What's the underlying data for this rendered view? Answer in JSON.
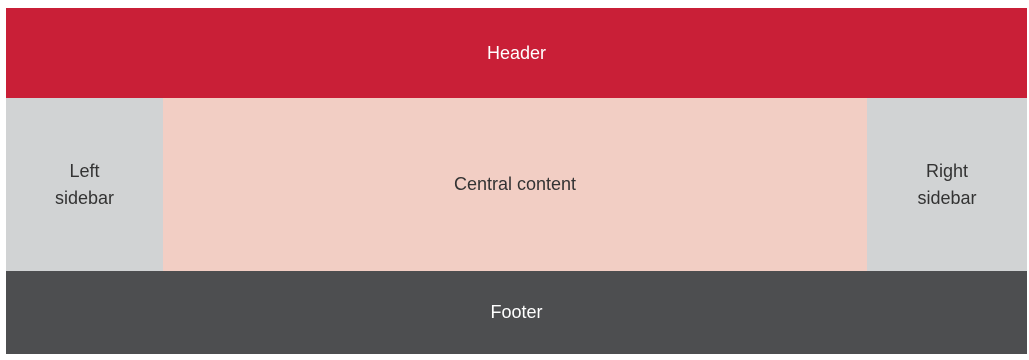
{
  "layout": {
    "header": {
      "label": "Header",
      "color": "#c91f37",
      "text_color": "#ffffff"
    },
    "left_sidebar": {
      "label": "Left sidebar",
      "color": "#d1d3d4",
      "text_color": "#333333"
    },
    "central_content": {
      "label": "Central content",
      "color": "#f2cec4",
      "text_color": "#333333"
    },
    "right_sidebar": {
      "label": "Right sidebar",
      "color": "#d1d3d4",
      "text_color": "#333333"
    },
    "footer": {
      "label": "Footer",
      "color": "#4d4e50",
      "text_color": "#ffffff"
    }
  }
}
